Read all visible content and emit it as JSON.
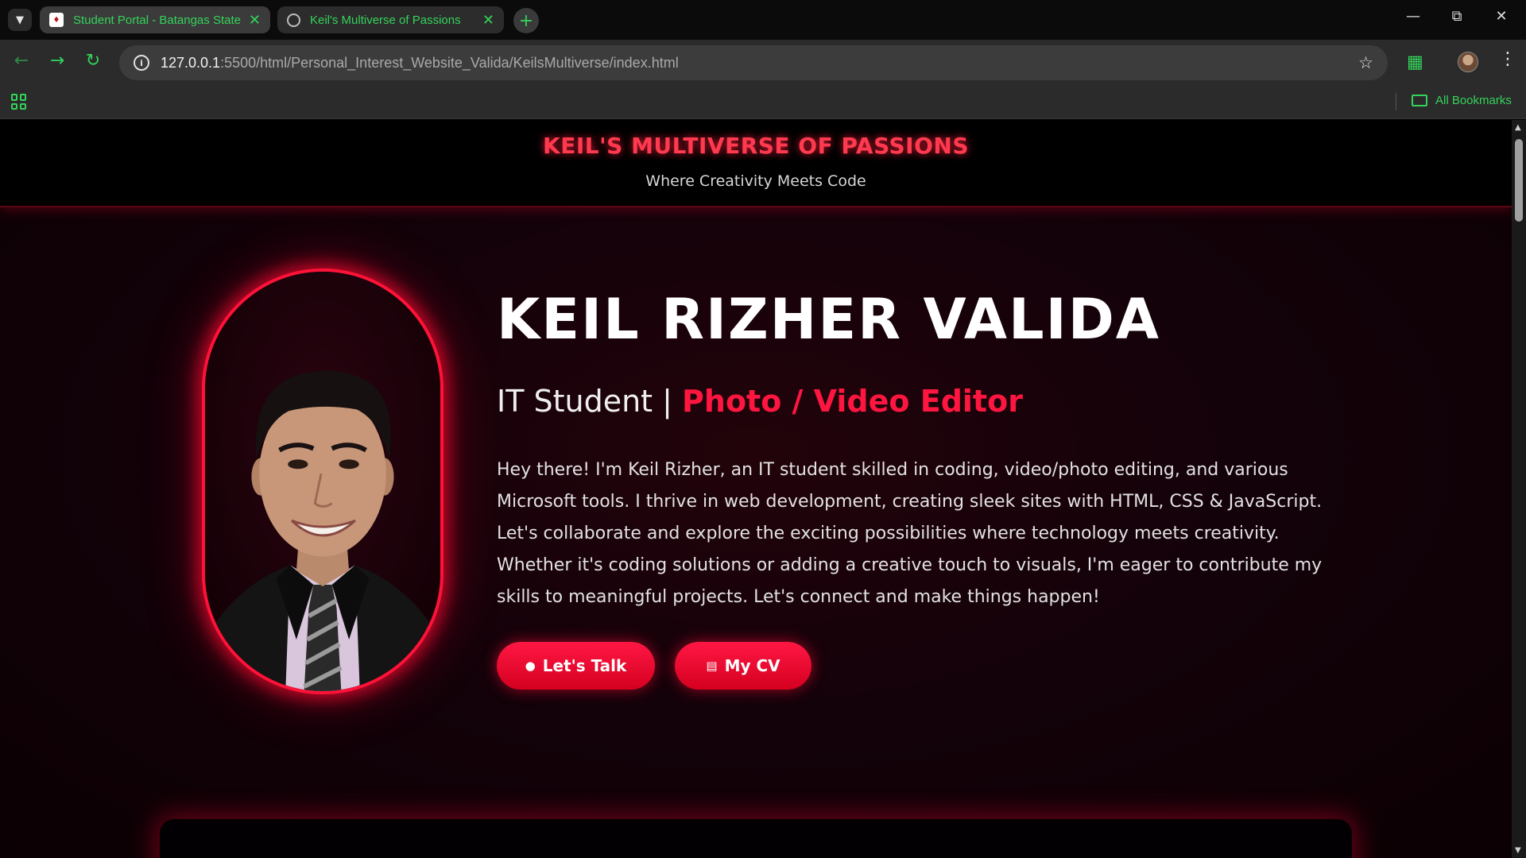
{
  "browser": {
    "tabs": [
      {
        "title": "Student Portal - Batangas State",
        "icon": "batstateu-shield-icon"
      },
      {
        "title": "Keil's Multiverse of Passions",
        "icon": "globe-icon"
      }
    ],
    "address": {
      "host": "127.0.0.1",
      "path": ":5500/html/Personal_Interest_Website_Valida/KeilsMultiverse/index.html"
    },
    "bookmarks_label": "All Bookmarks",
    "accent_color": "#34d35a"
  },
  "page": {
    "header": {
      "title": "KEIL'S MULTIVERSE OF PASSIONS",
      "subtitle": "Where Creativity Meets Code"
    },
    "hero": {
      "name": "KEIL RIZHER VALIDA",
      "role_prefix": "IT Student | ",
      "role_accent": "Photo / Video Editor",
      "bio": "Hey there! I'm Keil Rizher, an IT student skilled in coding, video/photo editing, and various Microsoft tools. I thrive in web development, creating sleek sites with HTML, CSS & JavaScript. Let's collaborate and explore the exciting possibilities where technology meets creativity. Whether it's coding solutions or adding a creative touch to visuals, I'm eager to contribute my skills to meaningful projects. Let's connect and make things happen!",
      "buttons": [
        {
          "label": "Let's Talk",
          "icon": "speech-bubble-icon"
        },
        {
          "label": "My CV",
          "icon": "document-icon"
        }
      ]
    },
    "accent_color": "#ff1640"
  }
}
